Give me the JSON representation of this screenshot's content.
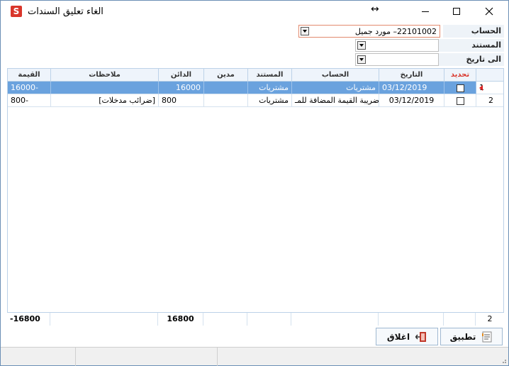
{
  "window": {
    "title": "الغاء تعليق السندات"
  },
  "filters": {
    "account": {
      "label": "الحساب",
      "code": "22101002",
      "name": "– مورد جميل"
    },
    "document": {
      "label": "المستند",
      "value": ""
    },
    "to_date": {
      "label": "الى تاريخ",
      "value": ""
    }
  },
  "grid": {
    "headers": {
      "select": "تحديد",
      "date": "التاريخ",
      "account": "الحساب",
      "document": "المستند",
      "debit": "مدين",
      "credit": "الدائن",
      "notes": "ملاحظات",
      "value": "القيمة"
    },
    "rows": [
      {
        "num": "1",
        "date": "03/12/2019",
        "account": "مشتريات",
        "document": "مشتريات",
        "debit": "",
        "credit": "16000",
        "notes": "",
        "value": "16000-",
        "selected": true
      },
      {
        "num": "2",
        "date": "03/12/2019",
        "account": "ضريبة القيمة المضافة للمـ",
        "document": "مشتريات",
        "debit": "",
        "credit": "800",
        "notes": "[ضرائب مدخلات]",
        "value": "800-",
        "selected": false
      }
    ],
    "footer": {
      "count": "2",
      "credit_total": "16800",
      "value_total": "-16800"
    }
  },
  "buttons": {
    "apply": "تطبيق",
    "close": "اغلاق"
  }
}
